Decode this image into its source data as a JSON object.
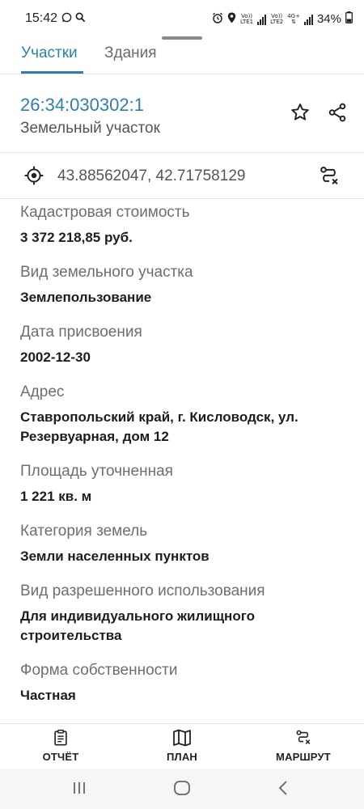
{
  "status_bar": {
    "time": "15:42",
    "sim1_top": "Vo))",
    "sim1_bottom": "LTE1",
    "sim2_top": "Vo))",
    "sim2_bottom": "LTE2",
    "network": "4G+",
    "battery": "34%"
  },
  "tabs": [
    {
      "label": "Участки",
      "active": true
    },
    {
      "label": "Здания",
      "active": false
    }
  ],
  "header": {
    "cadastral_number": "26:34:030302:1",
    "object_type": "Земельный участок"
  },
  "coordinates": "43.88562047, 42.71758129",
  "fields": [
    {
      "label": "Кадастровая стоимость",
      "value": "3 372 218,85 руб."
    },
    {
      "label": "Вид земельного участка",
      "value": "Землепользование"
    },
    {
      "label": "Дата присвоения",
      "value": "2002-12-30"
    },
    {
      "label": "Адрес",
      "value": "Ставропольский край, г. Кисловодск, ул. Резервуарная, дом 12"
    },
    {
      "label": "Площадь уточненная",
      "value": "1 221 кв. м"
    },
    {
      "label": "Категория земель",
      "value": "Земли населенных пунктов"
    },
    {
      "label": "Вид разрешенного использования",
      "value": "Для индивидуального жилищного строительства"
    },
    {
      "label": "Форма собственности",
      "value": "Частная"
    }
  ],
  "bottom_nav": {
    "report": "ОТЧЁТ",
    "plan": "ПЛАН",
    "route": "МАРШРУТ"
  },
  "colors": {
    "accent": "#2f7fae",
    "text_primary": "#1d1d1d",
    "text_secondary": "#6e6e6e",
    "divider": "#e2e2e2"
  },
  "icons": {
    "favorite": "star-outline-icon",
    "share": "share-icon",
    "location": "target-icon",
    "route": "route-icon",
    "report": "clipboard-icon",
    "plan": "map-icon"
  }
}
